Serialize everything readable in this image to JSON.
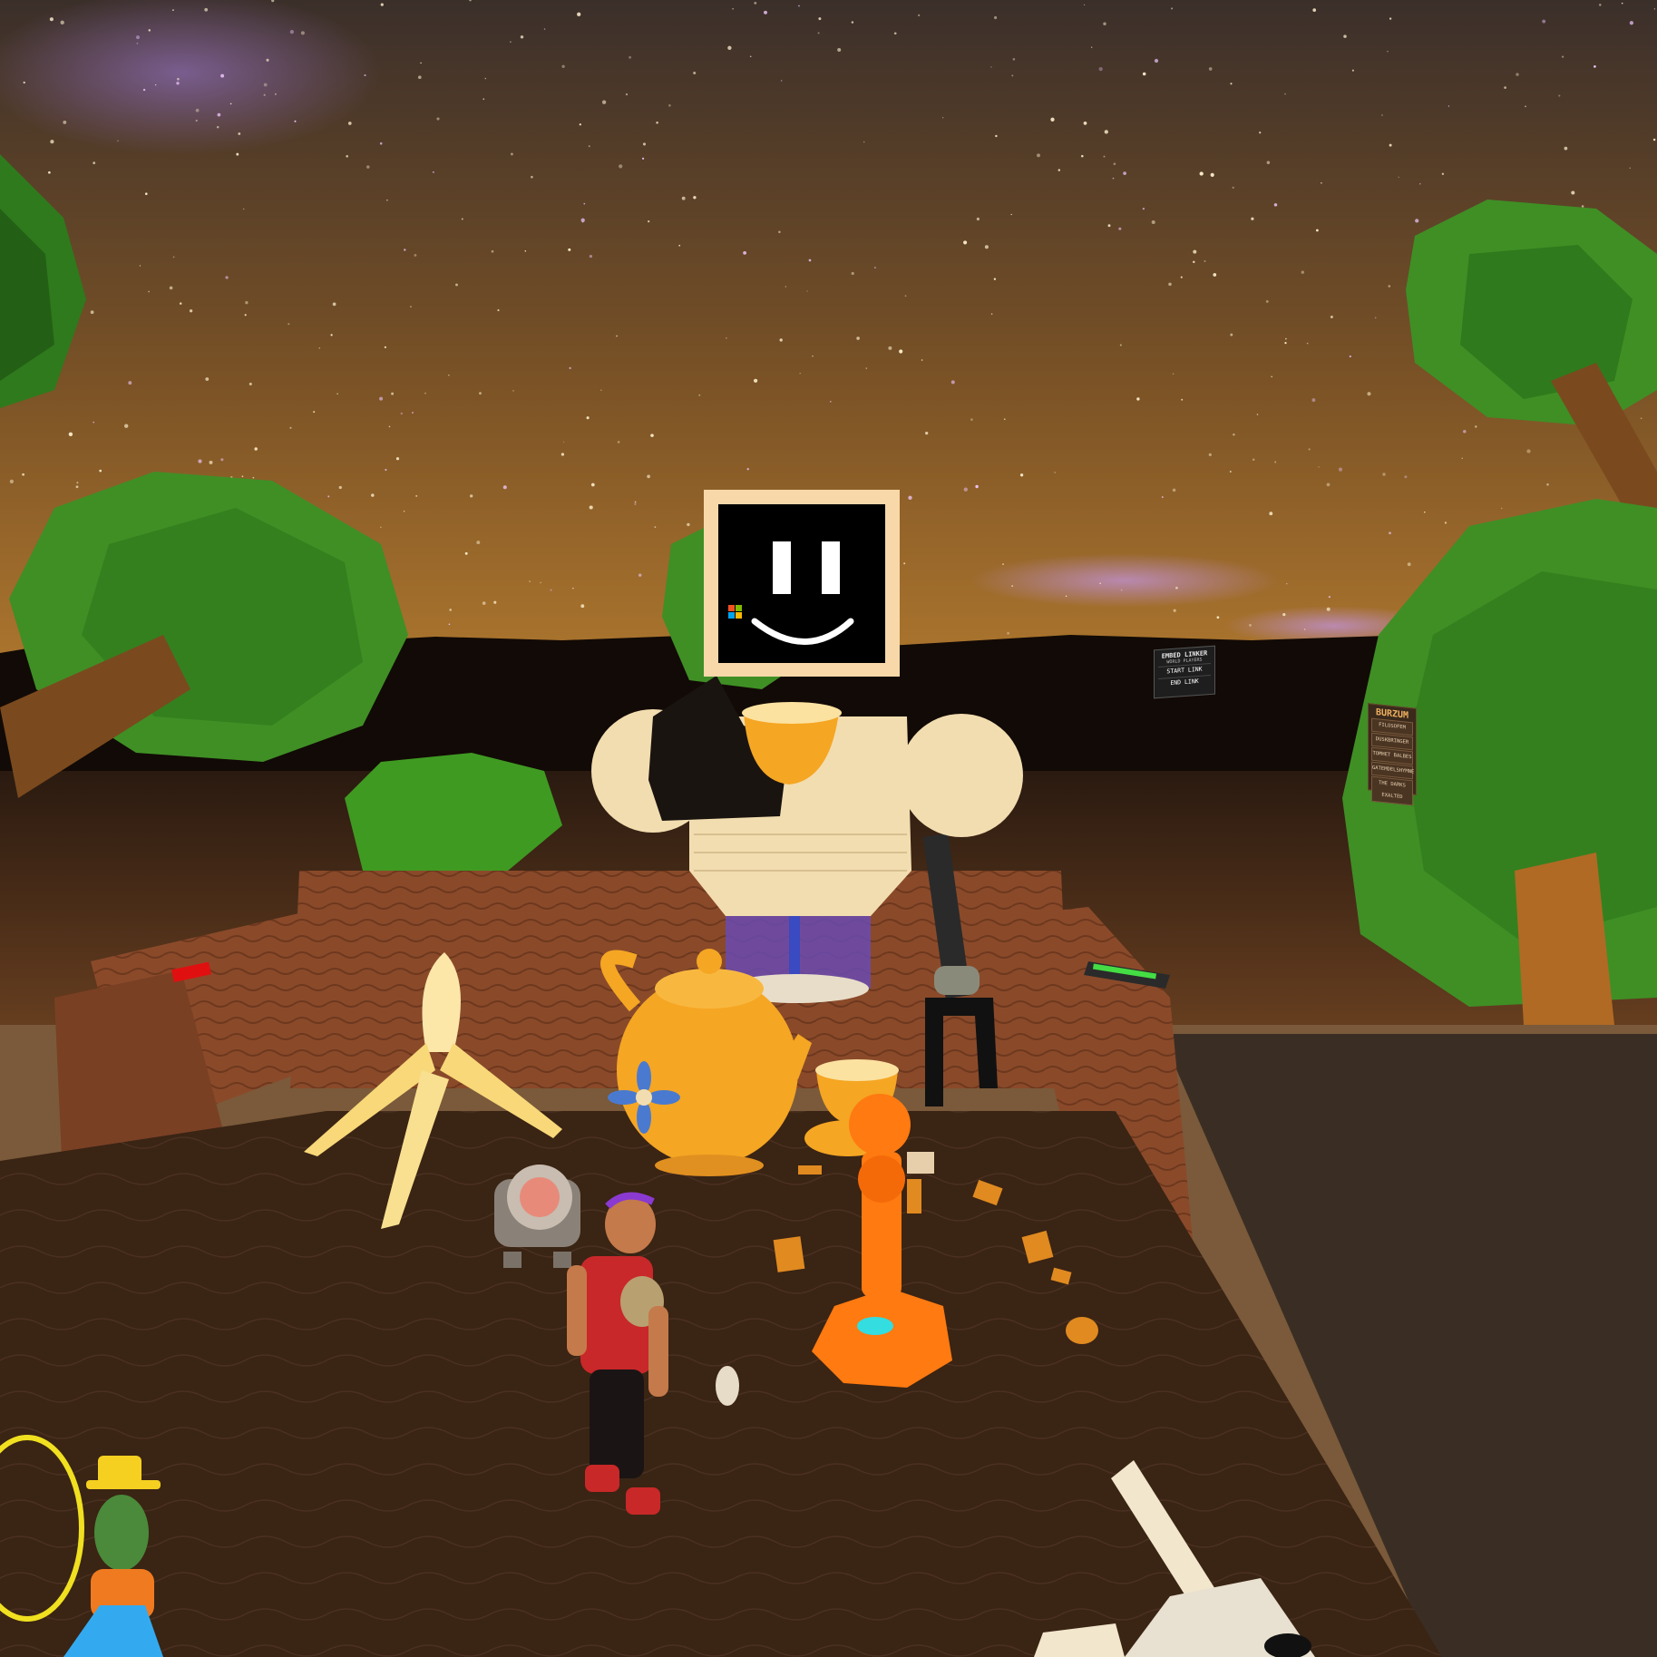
{
  "colors": {
    "sky_top": "#3b2f2a",
    "sky_horizon": "#9a6a2a",
    "tree_green": "#3f8f25",
    "table_brown": "#3a2414",
    "couch_brown": "#8a4a2a",
    "robot_cream": "#f2ddb0",
    "robot_screen": "#000000",
    "teapot_orange": "#f5a623",
    "accent_red": "#e01010",
    "accent_green": "#44dd44"
  },
  "icons": [
    "smiley-face-icon",
    "windows-logo-icon"
  ],
  "world_linker": {
    "title": "EMBED LINKER",
    "subtitle_left": "WORLD",
    "subtitle_right": "PLAYERS",
    "start_label": "START LINK",
    "end_label": "END LINK"
  },
  "menu_sign": {
    "title": "BURZUM",
    "items": [
      "FILOSOFEM",
      "DUSKBRINGER",
      "TOMHET BALBES",
      "GATEMDELSHYMNE",
      "THE DARKS EXALTED"
    ]
  }
}
